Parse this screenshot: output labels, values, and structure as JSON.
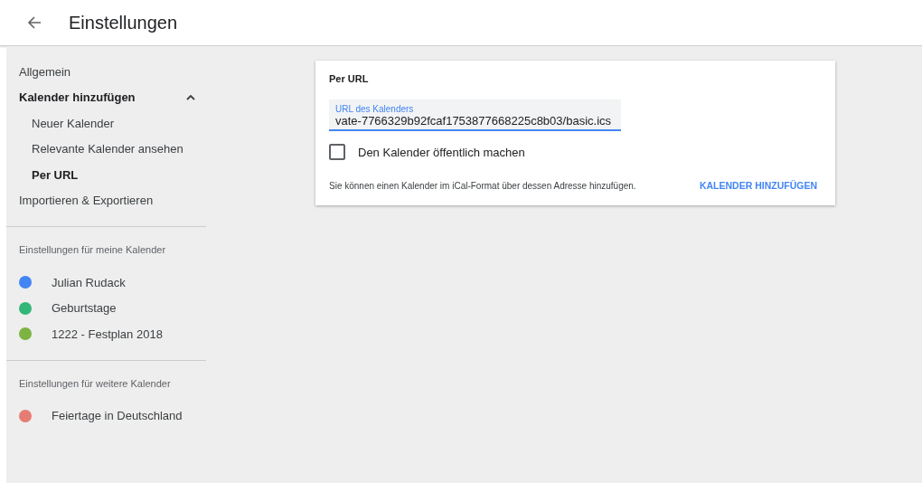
{
  "header": {
    "title": "Einstellungen"
  },
  "nav": [
    {
      "label": "Allgemein",
      "selected": false
    },
    {
      "label": "Kalender hinzufügen",
      "selected": true,
      "expanded": true,
      "children": [
        {
          "label": "Neuer Kalender",
          "selected": false
        },
        {
          "label": "Relevante Kalender ansehen",
          "selected": false
        },
        {
          "label": "Per URL",
          "selected": true
        }
      ]
    },
    {
      "label": "Importieren & Exportieren",
      "selected": false
    }
  ],
  "calendar_sections": [
    {
      "heading": "Einstellungen für meine Kalender",
      "calendars": [
        {
          "name": "Julian Rudack",
          "color": "#4285f4"
        },
        {
          "name": "Geburtstage",
          "color": "#33b679"
        },
        {
          "name": "1222 - Festplan 2018",
          "color": "#7cb342"
        }
      ]
    },
    {
      "heading": "Einstellungen für weitere Kalender",
      "calendars": [
        {
          "name": "Feiertage in Deutschland",
          "color": "#e67c73"
        }
      ]
    }
  ],
  "card": {
    "title": "Per URL",
    "url_field": {
      "label": "URL des Kalenders",
      "value": "vate-7766329b92fcaf1753877668225c8b03/basic.ics"
    },
    "public_checkbox": {
      "label": "Den Kalender öffentlich machen",
      "checked": false
    },
    "hint": "Sie können einen Kalender im iCal-Format über dessen Adresse hinzufügen.",
    "button": "KALENDER HINZUFÜGEN"
  }
}
